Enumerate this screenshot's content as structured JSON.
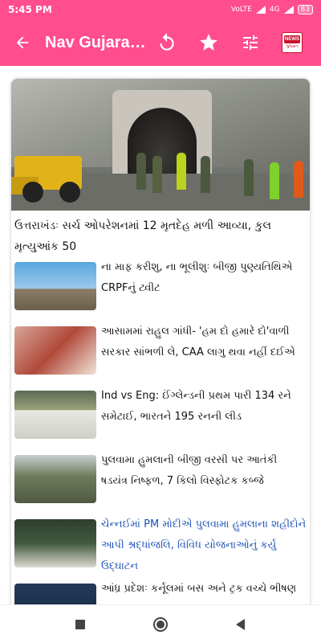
{
  "status_bar": {
    "time": "5:45 PM",
    "net1": "VoLTE",
    "net2": "4G",
    "battery": "83"
  },
  "app_bar": {
    "title": "Nav Gujarat Samay",
    "logo_text_top": "NEWS",
    "logo_text_bottom": "ગુજરાત"
  },
  "icons": {
    "back": "arrow-left-icon",
    "refresh": "refresh-icon",
    "star": "star-icon",
    "settings": "tune-sliders-icon",
    "home_nav": "circle-home-icon",
    "recent_nav": "square-recent-icon",
    "back_nav": "triangle-back-icon"
  },
  "colors": {
    "accent": "#ff4d8d",
    "link_blue": "#1a4fb5",
    "text": "#111111"
  },
  "feed": {
    "hero_headline": "ઉત્તરાખંડઃ સર્ચ ઓપરેશનમાં 12 મૃતદેહ મળી આવ્યા, કુલ મૃત્યુઆંક 50",
    "items": [
      {
        "headline": "ના માફ કરીશુ, ના ભૂલીશુઃ બીજી પુણ્યતિથિએ CRPFનું ટ્વીટ"
      },
      {
        "headline": "આસામમાં રાહુલ ગાંધી- 'હમ દો હમારે દો'વાળી સરકાર સાંભળી લે, CAA લાગુ થવા નહીં દઈએ"
      },
      {
        "headline": "Ind vs Eng: ઈંગ્લેન્ડની પ્રથમ પારી 134 રને સમેટાઈ, ભારતને 195 રનની લીડ"
      },
      {
        "headline": "પુલવામા હુમલાની બીજી વરસી પર આતંકી ષડયંત્ર નિષ્ફળ, 7 કિલો વિસ્ફોટક કબ્જે"
      },
      {
        "headline": "ચેન્નઈમાં PM મોદીએ પુલવામા હુમલાના શહીદોને આપી શ્રદ્ધાંજલિ, વિવિધ યોજનાઓનું કર્યુ ઉદ્ઘાટન"
      },
      {
        "headline": "આંધ્ર પ્રદેશઃ કર્નૂલમાં બસ અને ટ્રક વચ્ચે ભીષણ"
      }
    ]
  }
}
